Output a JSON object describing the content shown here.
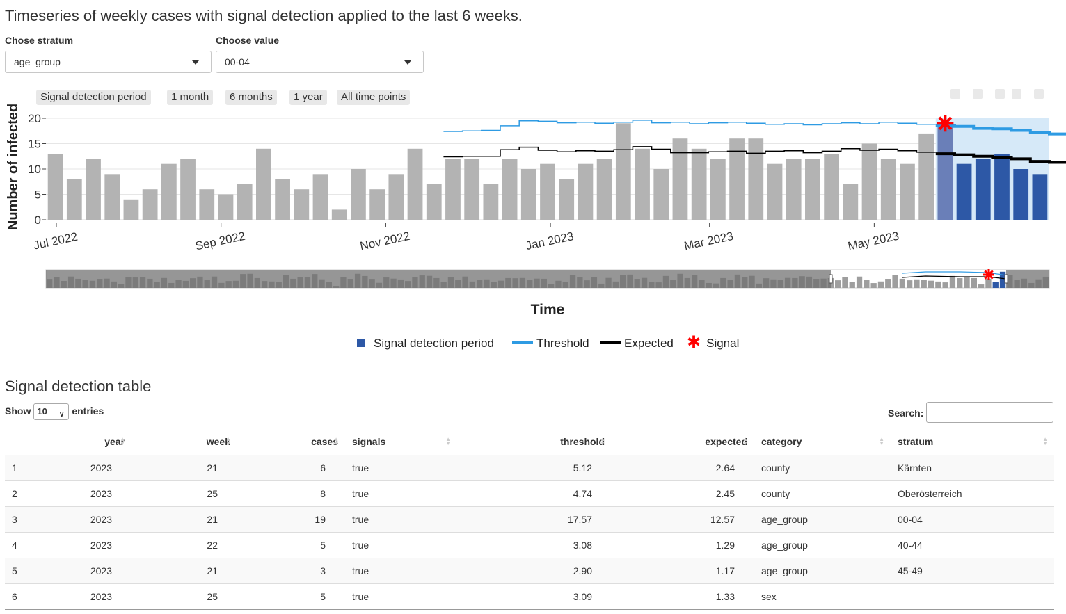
{
  "page": {
    "title": "Timeseries of weekly cases with signal detection applied to the last 6 weeks.",
    "table_title": "Signal detection table"
  },
  "controls": {
    "stratum_label": "Chose stratum",
    "stratum_value": "age_group",
    "value_label": "Choose value",
    "value_value": "00-04"
  },
  "range_buttons": [
    "Signal detection period",
    "1 month",
    "6 months",
    "1 year",
    "All time points"
  ],
  "colors": {
    "history_bar": "#b3b3b3",
    "signal_period_bar": "#2d58a6",
    "threshold": "#2e9be3",
    "expected": "#000000",
    "signal": "#ff0000",
    "signal_band": "#d6e9f8"
  },
  "icons": [
    "camera-icon",
    "zoom-icon",
    "pan-icon",
    "reset-axes-icon",
    "plotly-logo-icon"
  ],
  "chart_data": {
    "type": "bar",
    "ylabel": "Number of infected",
    "xlabel": "Time",
    "ylim": [
      0,
      20
    ],
    "y_ticks": [
      "0",
      "5",
      "10",
      "15",
      "20"
    ],
    "x_ticks": [
      "Jul 2022",
      "Sep 2022",
      "Nov 2022",
      "Jan 2023",
      "Mar 2023",
      "May 2023"
    ],
    "weeks": 52,
    "series": [
      {
        "name": "cases",
        "values": [
          13,
          8,
          12,
          9,
          4,
          6,
          11,
          12,
          6,
          5,
          7,
          14,
          8,
          6,
          9,
          2,
          10,
          6,
          9,
          14,
          7,
          12,
          12,
          7,
          12,
          10,
          11,
          8,
          11,
          12,
          19,
          14,
          10,
          16,
          14,
          12,
          16,
          16,
          11,
          12,
          12,
          13,
          7,
          15,
          12,
          11,
          17,
          19,
          11,
          12,
          13,
          10,
          9
        ]
      },
      {
        "name": "Threshold",
        "start_index": 21,
        "values": [
          17.4,
          17.5,
          17.6,
          18.5,
          19.5,
          19.4,
          19.1,
          19.2,
          19.0,
          19.2,
          19.6,
          19.1,
          19.2,
          18.9,
          19.1,
          19.2,
          19.0,
          18.8,
          18.9,
          18.7,
          18.9,
          19.1,
          18.9,
          19.2,
          19.0,
          18.8,
          18.6,
          18.4,
          18.0,
          17.9,
          17.6,
          17.2,
          16.9,
          16.5,
          16.1,
          15.9
        ]
      },
      {
        "name": "Expected",
        "start_index": 21,
        "values": [
          12.4,
          12.5,
          12.5,
          13.8,
          14.3,
          13.7,
          13.4,
          13.6,
          13.5,
          13.8,
          14.4,
          13.9,
          13.2,
          13.2,
          13.4,
          13.5,
          13.1,
          13.5,
          13.6,
          13.2,
          13.5,
          14.0,
          13.7,
          13.9,
          13.6,
          13.3,
          13.0,
          12.8,
          12.5,
          12.3,
          12.0,
          11.5,
          11.3,
          11.2,
          11.1,
          11.1
        ]
      }
    ],
    "signal_period_start_index": 47,
    "signal_index": 47,
    "signal_value": 19,
    "legend": [
      "Signal detection period",
      "Threshold",
      "Expected",
      "Signal"
    ]
  },
  "table": {
    "show_label": "Show",
    "entries_label": "entries",
    "length_value": "10",
    "search_label": "Search:",
    "columns": [
      "",
      "year",
      "week",
      "cases",
      "signals",
      "threshold",
      "expected",
      "category",
      "stratum"
    ],
    "rows": [
      [
        "1",
        "2023",
        "21",
        "6",
        "true",
        "5.12",
        "2.64",
        "county",
        "Kärnten"
      ],
      [
        "2",
        "2023",
        "25",
        "8",
        "true",
        "4.74",
        "2.45",
        "county",
        "Oberösterreich"
      ],
      [
        "3",
        "2023",
        "21",
        "19",
        "true",
        "17.57",
        "12.57",
        "age_group",
        "00-04"
      ],
      [
        "4",
        "2023",
        "22",
        "5",
        "true",
        "3.08",
        "1.29",
        "age_group",
        "40-44"
      ],
      [
        "5",
        "2023",
        "21",
        "3",
        "true",
        "2.90",
        "1.17",
        "age_group",
        "45-49"
      ],
      [
        "6",
        "2023",
        "25",
        "5",
        "true",
        "3.09",
        "1.33",
        "sex",
        ""
      ]
    ]
  }
}
